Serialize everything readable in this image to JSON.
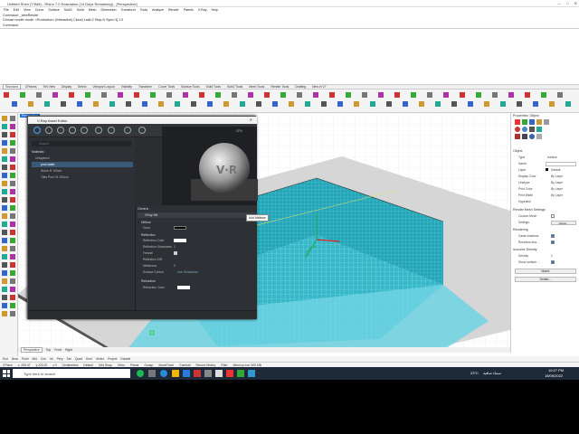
{
  "window": {
    "title": "Untitled Shim (T3M8) - Rhino 7.0 Evaluation (14 Days Remaining) - [Perspective]"
  },
  "menu": [
    "File",
    "Edit",
    "View",
    "Curve",
    "Surface",
    "SubD",
    "Solid",
    "Mesh",
    "Dimension",
    "Transform",
    "Tools",
    "Analyze",
    "Render",
    "Panels",
    "V-Ray",
    "Help"
  ],
  "command_history": [
    "Command: _viewRender",
    "Choose render mode: <Production> (Interactive) Cloud)  Ladl=2  Stop=0 Sync=1] 1.0",
    "Command:"
  ],
  "toolbar_tabs": [
    "Standard",
    "CPlanes",
    "Set View",
    "Display",
    "Select",
    "Viewport Layout",
    "Visibility",
    "Transform",
    "Curve Tools",
    "Surface Tools",
    "Solid Tools",
    "SubD Tools",
    "Mesh Tools",
    "Render Tools",
    "Drafting",
    "New in V7"
  ],
  "active_toolbar_tab": "Standard",
  "viewport": {
    "label": "Perspective"
  },
  "view_tabs": [
    "Perspective",
    "Top",
    "Front",
    "Right"
  ],
  "active_view_tab": "Perspective",
  "snaps": [
    "End",
    "Near",
    "Point",
    "Mid",
    "Cen",
    "Int",
    "Perp",
    "Tan",
    "Quad",
    "Knot",
    "Vertex",
    "Project",
    "Disable"
  ],
  "status": [
    "CPlane",
    "x -293.47",
    "y 223.20",
    "z 0",
    "Centimeters",
    "Default",
    "Grid Snap",
    "Ortho",
    "Planar",
    "Osnap",
    "SmartTrack",
    "Gumball",
    "Record History",
    "Filter",
    "Memory use: 505 MB"
  ],
  "taskbar": {
    "search_placeholder": "Type here to search",
    "time": "10:27 PM",
    "date": "18/09/2022",
    "temperature": "23°C",
    "weather": "سماء صافية"
  },
  "vray_editor": {
    "title": "V-Ray Asset Editor",
    "search_placeholder": "Search",
    "tree_header": "Materials",
    "items": [
      "Unlayered",
      "pool water",
      "Stone H 100cm",
      "Tiles Pool 01 100cm"
    ],
    "preview_renderer": "CPU",
    "section_generic": "Generic",
    "layer_title": "VRay Mtl",
    "diffuse": {
      "header": "Diffuse",
      "color_label": "Color"
    },
    "reflection": {
      "header": "Reflection",
      "rows": [
        "Reflection Color",
        "Reflection Glossiness",
        "Fresnel",
        "Reflection IOR",
        "Metalness",
        "Surface Control"
      ],
      "glossiness": "1",
      "metalness": "0",
      "surface_control": "Use Glossiness"
    },
    "refraction": {
      "header": "Refraction",
      "row": "Refraction Color"
    },
    "tooltip": "Add Attribute"
  },
  "properties": {
    "header": "Properties: Object",
    "section_object": "Object",
    "type_label": "Type",
    "type_value": "surface",
    "name_label": "Name",
    "layer_label": "Layer",
    "layer_value": "Default",
    "display_color_label": "Display Color",
    "display_color_value": "By Layer",
    "linetype_label": "Linetype",
    "linetype_value": "By Layer",
    "print_color_label": "Print Color",
    "print_color_value": "By Layer",
    "print_width_label": "Print Width",
    "print_width_value": "By Layer",
    "hyperlink_label": "Hyperlink",
    "render_mesh": "Render Mesh Settings",
    "custom_mesh": "Custom Mesh",
    "settings": "Settings",
    "adjust": "Adjust...",
    "rendering": "Rendering",
    "casts_shadows": "Casts shadows",
    "receives_shadows": "Receives sha...",
    "isocurve": "Isocurve Density",
    "density_label": "Density",
    "density_value": "1",
    "show_surface": "Show surface...",
    "match": "Match",
    "details": "Details..."
  },
  "colors": {
    "water": "#6fd3e3",
    "tile_dark": "#1fa3b5",
    "ground": "#d9d9d9",
    "panel_dark": "#2b2d31",
    "accent": "#1e6fd9"
  }
}
